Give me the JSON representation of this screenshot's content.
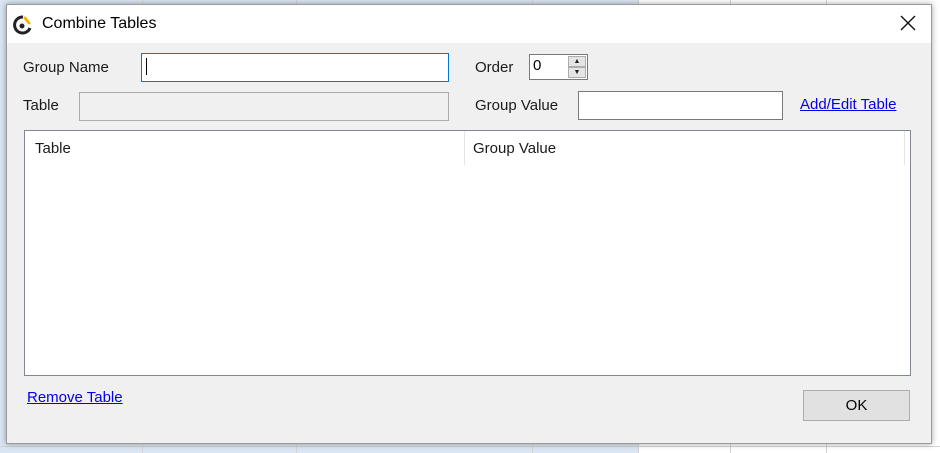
{
  "dialog": {
    "title": "Combine Tables",
    "icons": {
      "app": "app-logo-icon",
      "close": "close-icon"
    }
  },
  "form": {
    "group_name_label": "Group Name",
    "group_name_value": "",
    "order_label": "Order",
    "order_value": "0",
    "table_label": "Table",
    "table_value": "",
    "group_value_label": "Group Value",
    "group_value_value": "",
    "add_edit_link": "Add/Edit Table"
  },
  "grid": {
    "columns": [
      "Table",
      "Group Value"
    ],
    "rows": []
  },
  "footer": {
    "remove_link": "Remove Table",
    "ok_label": "OK"
  },
  "colors": {
    "dialog_bg": "#f0f0f0",
    "link": "#0000ee",
    "focus_border": "#0078d7"
  }
}
